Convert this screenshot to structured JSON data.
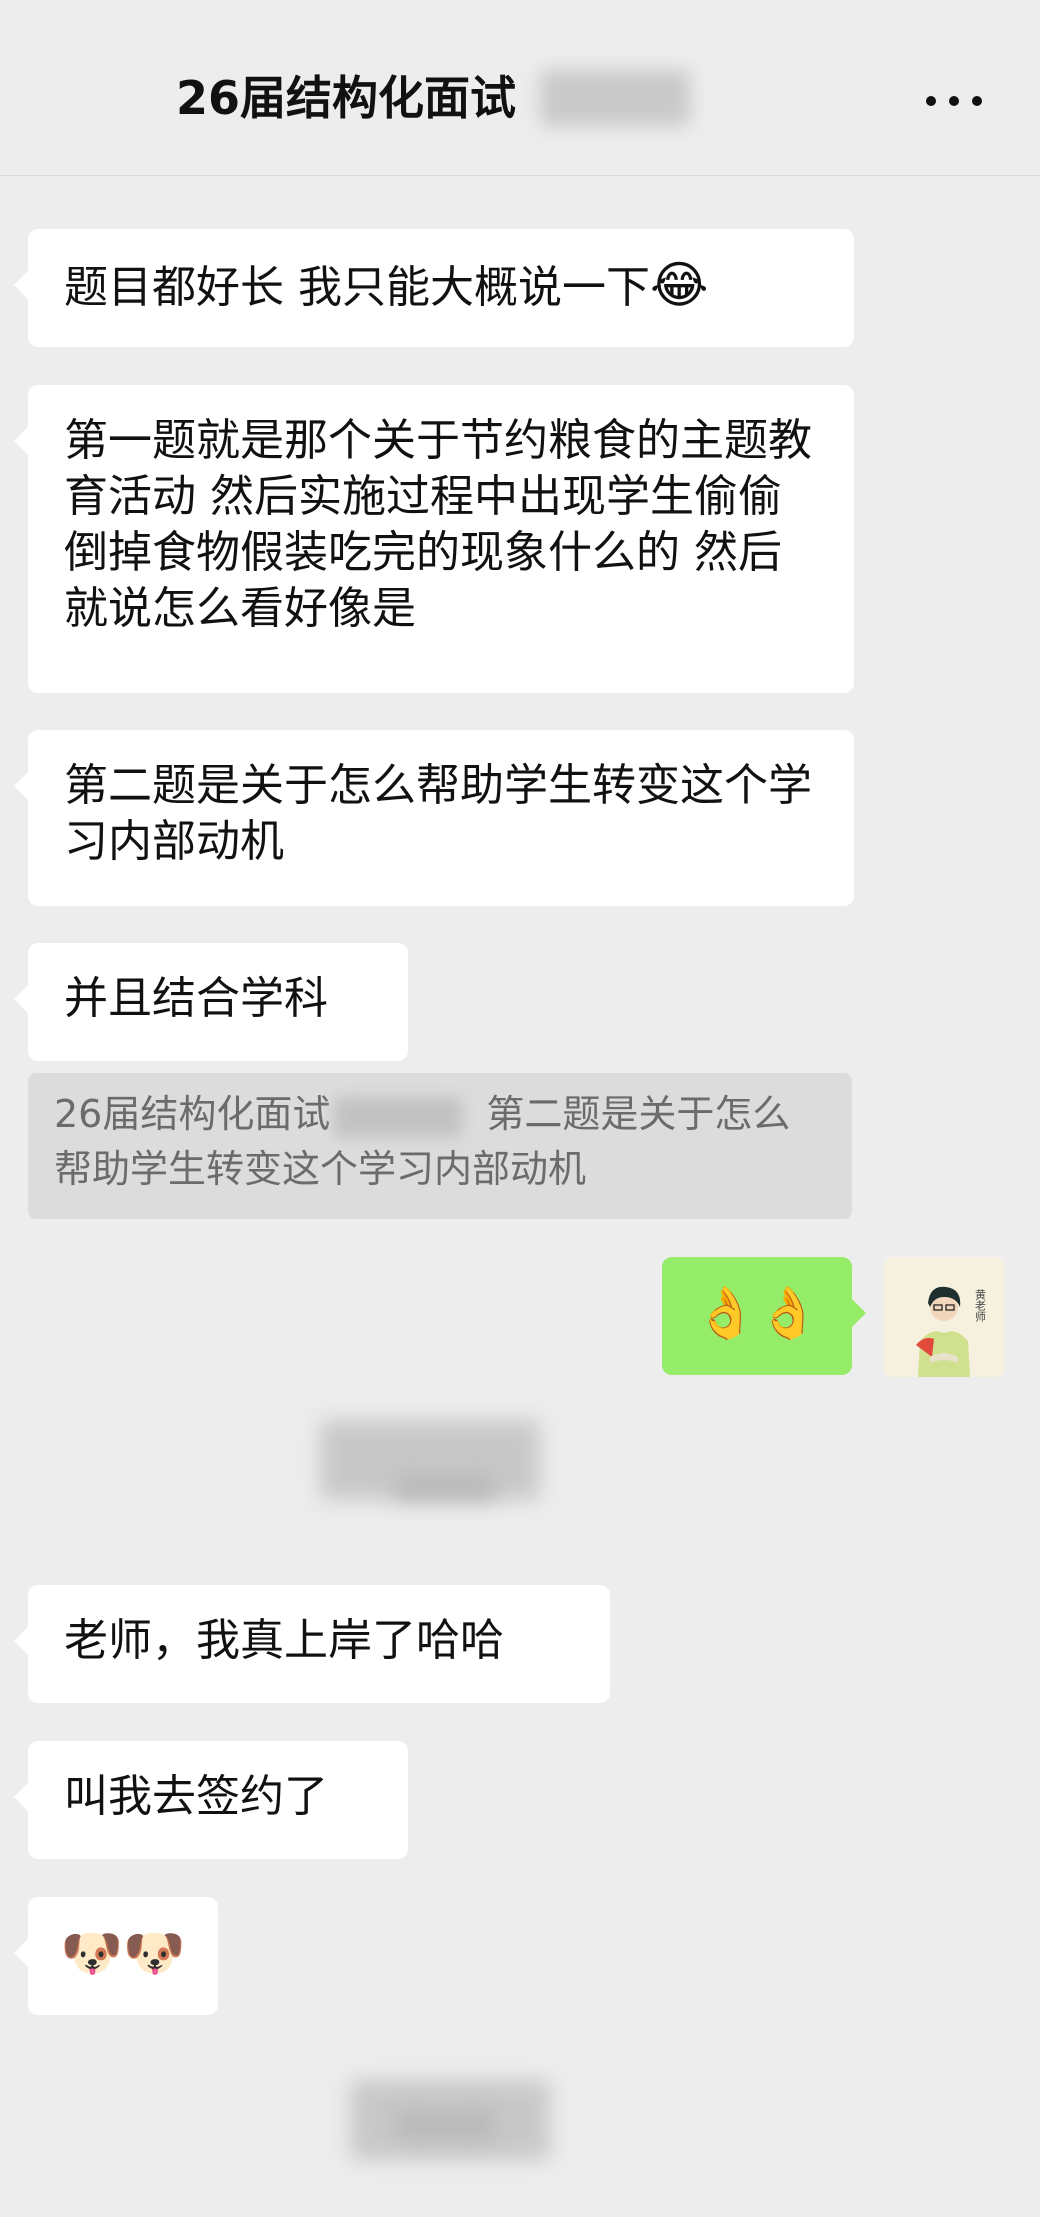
{
  "header": {
    "title": "26届结构化面试"
  },
  "messages": [
    {
      "text": "题目都好长 我只能大概说一下",
      "emoji": "😂"
    },
    {
      "text": "第一题就是那个关于节约粮食的主题教育活动 然后实施过程中出现学生偷偷倒掉食物假装吃完的现象什么的 然后就说怎么看好像是"
    },
    {
      "text": "第二题是关于怎么帮助学生转变这个学习内部动机"
    },
    {
      "text": "并且结合学科"
    }
  ],
  "quote": {
    "sender": "26届结构化面试",
    "text": "第二题是关于怎么帮助学生转变这个学习内部动机"
  },
  "reply": {
    "emoji": "👌👌"
  },
  "avatar": {
    "label": "黄老师"
  },
  "messages2": [
    {
      "text": "老师，我真上岸了哈哈"
    },
    {
      "text": "叫我去签约了"
    },
    {
      "emoji": "🐶🐶"
    }
  ]
}
